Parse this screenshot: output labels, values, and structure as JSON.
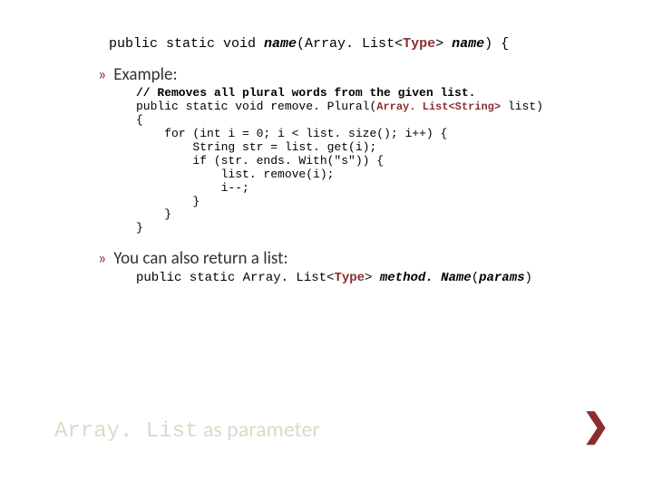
{
  "signature": {
    "prefix": "public static void ",
    "method": "name",
    "open": "(Array. List<",
    "type": "Type",
    "close": "> ",
    "param": "name",
    "tail": ") {"
  },
  "bullet1": "Example:",
  "code": {
    "comment": "// Removes all plural words from the given list.",
    "l1a": "public static void remove. Plural(",
    "l1b": "Array. List<String>",
    "l1c": " list)",
    "l2": "{",
    "l3": "    for (int i = 0; i < list. size(); i++) {",
    "l4": "        String str = list. get(i);",
    "l5": "        if (str. ends. With(\"s\")) {",
    "l6": "            list. remove(i);",
    "l7": "            i--;",
    "l8": "        }",
    "l9": "    }",
    "l10": "}"
  },
  "bullet2": "You can also return a list:",
  "retsig": {
    "prefix": "public static Array. List<",
    "type": "Type",
    "mid": "> ",
    "method": " method. Name",
    "open": "(",
    "params": "params",
    "close": ")"
  },
  "title": {
    "mono": "Array. List",
    "rest": " as parameter"
  },
  "chevron": "❯"
}
